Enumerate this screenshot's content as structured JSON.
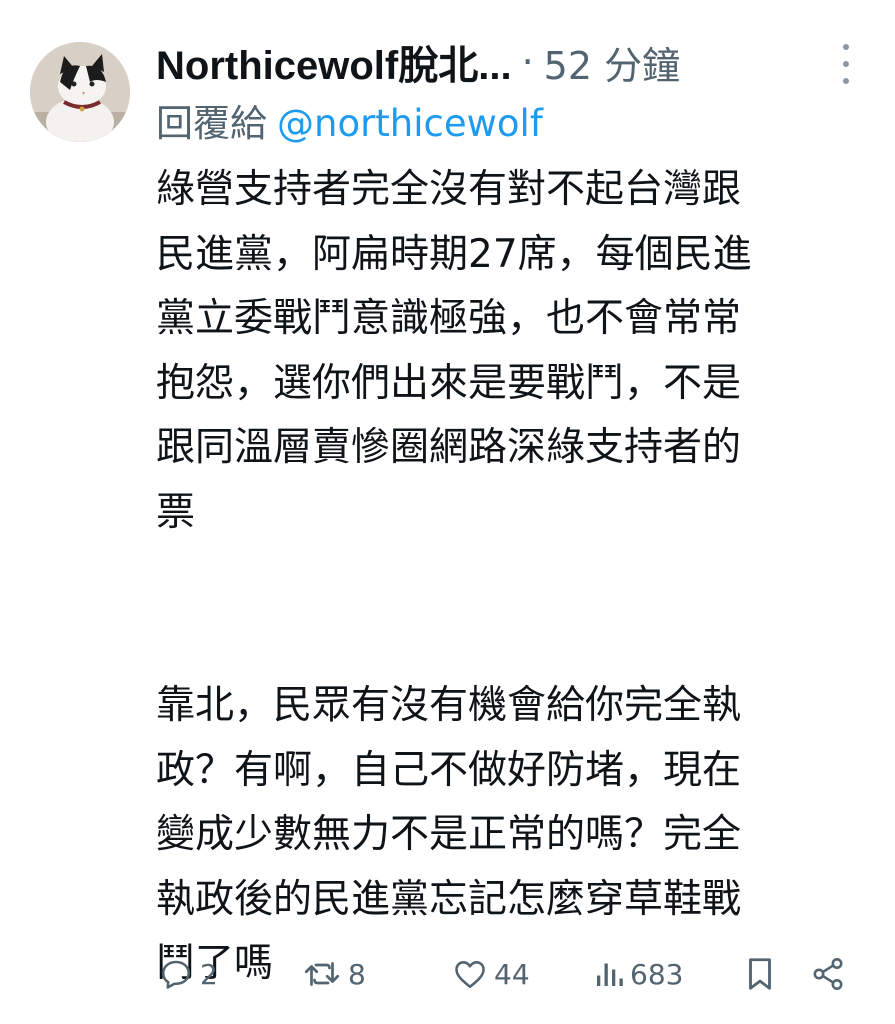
{
  "tweet": {
    "display_name": "Northicewolf脫北...",
    "separator": "·",
    "time": "52 分鐘",
    "replying_to_label": "回覆給",
    "replying_to_handle": "@northicewolf",
    "paragraph1_lines": [
      "綠營支持者完全沒有對不起台灣跟",
      "民進黨，阿扁時期27席，每個民進",
      "黨立委戰鬥意識極強，也不會常常",
      "抱怨，選你們出來是要戰鬥，不是",
      "跟同溫層賣慘圈網路深綠支持者的",
      "票"
    ],
    "paragraph2_lines": [
      "靠北，民眾有沒有機會給你完全執",
      "政？有啊，自己不做好防堵，現在",
      "變成少數無力不是正常的嗎？完全",
      "執政後的民進黨忘記怎麼穿草鞋戰",
      "鬥了嗎"
    ]
  },
  "actions": {
    "reply": {
      "icon": "reply-icon",
      "count": "2"
    },
    "repost": {
      "icon": "repost-icon",
      "count": "8"
    },
    "like": {
      "icon": "heart-icon",
      "count": "44"
    },
    "views": {
      "icon": "views-icon",
      "count": "683"
    },
    "bookmark": {
      "icon": "bookmark-icon"
    },
    "share": {
      "icon": "share-icon"
    }
  },
  "colors": {
    "text": "#0f1419",
    "secondary": "#536471",
    "link": "#1d9bf0"
  }
}
